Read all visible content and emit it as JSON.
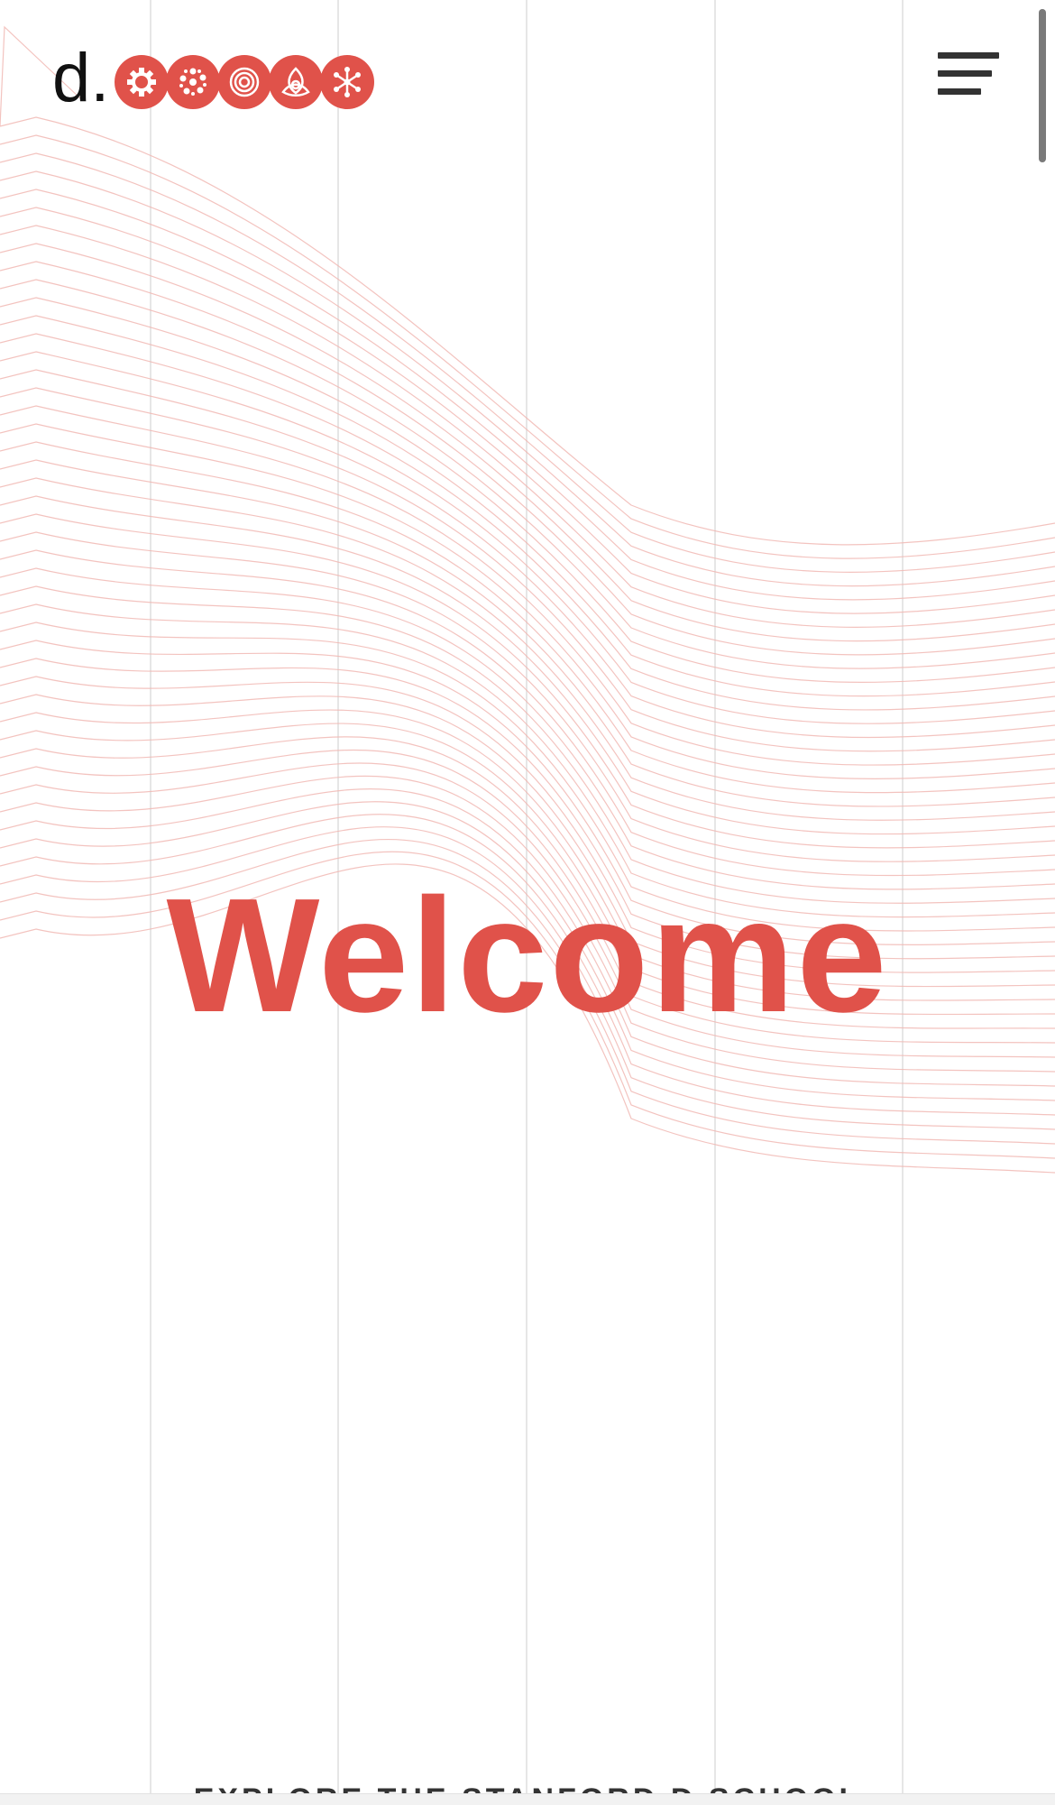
{
  "header": {
    "logo_letter": "d.",
    "logo_icons": [
      "gear-icon",
      "cluster-icon",
      "target-icon",
      "triquetra-icon",
      "network-icon"
    ],
    "menu_icon": "hamburger-menu-icon"
  },
  "hero": {
    "title": "Welcome"
  },
  "footer": {
    "explore_link": "EXPLORE THE STANFORD D.SCHOOL"
  },
  "colors": {
    "brand_red": "#e0524a",
    "text_dark": "#111111",
    "grid_line": "#e6e6e6",
    "wave_line": "#f1b9b4"
  }
}
